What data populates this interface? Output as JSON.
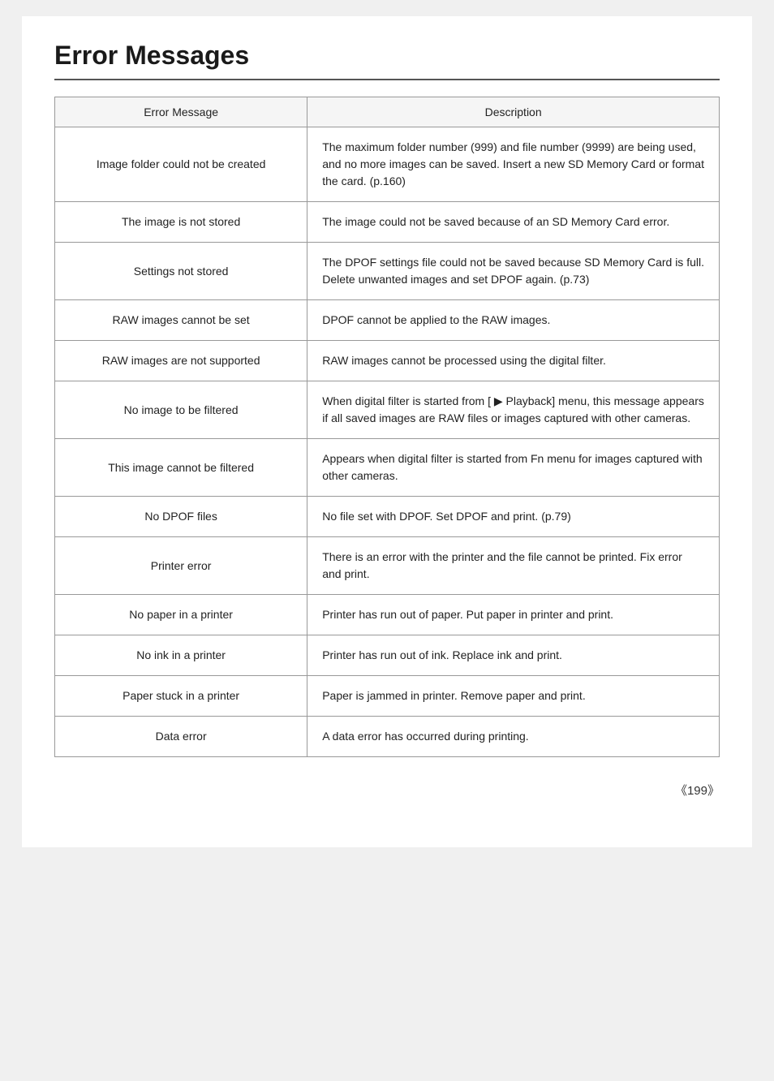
{
  "page": {
    "title": "Error Messages",
    "page_number": "《199》"
  },
  "table": {
    "col1_header": "Error Message",
    "col2_header": "Description",
    "rows": [
      {
        "error": "Image folder could not be created",
        "description": "The maximum folder number (999) and file number (9999) are being used, and no more images can be saved. Insert a new SD Memory Card or format the card. (p.160)"
      },
      {
        "error": "The image is not stored",
        "description": "The image could not be saved because of an SD Memory Card error."
      },
      {
        "error": "Settings not stored",
        "description": "The DPOF settings file could not be saved because SD Memory Card is full. Delete unwanted images and set DPOF again. (p.73)"
      },
      {
        "error": "RAW images cannot be set",
        "description": "DPOF cannot be applied to the RAW images."
      },
      {
        "error": "RAW images are not supported",
        "description": "RAW images cannot be processed using the digital filter."
      },
      {
        "error": "No image to be filtered",
        "description": "When digital filter is started from [ ▶ Playback] menu, this message appears if all saved images are RAW files or images captured with other cameras."
      },
      {
        "error": "This image cannot be filtered",
        "description": "Appears when digital filter is started from Fn menu for images captured with other cameras."
      },
      {
        "error": "No DPOF files",
        "description": "No file set with DPOF. Set DPOF and print. (p.79)"
      },
      {
        "error": "Printer error",
        "description": "There is an error with the printer and the file cannot be printed. Fix error and print."
      },
      {
        "error": "No paper in a printer",
        "description": "Printer has run out of paper. Put paper in printer and print."
      },
      {
        "error": "No ink in a printer",
        "description": "Printer has run out of ink. Replace ink and print."
      },
      {
        "error": "Paper stuck in a printer",
        "description": "Paper is jammed in printer. Remove paper and print."
      },
      {
        "error": "Data error",
        "description": "A data error has occurred during printing."
      }
    ]
  }
}
